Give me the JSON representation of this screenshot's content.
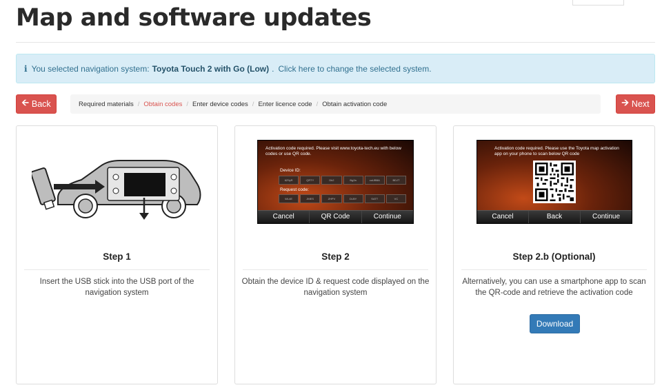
{
  "page": {
    "title": "Map and software updates"
  },
  "alert": {
    "icon": "info-icon",
    "prefix": "You selected navigation system:",
    "system": "Toyota Touch 2 with Go (Low)",
    "suffix": ".",
    "link": "Click here to change the selected system."
  },
  "nav": {
    "back_label": "Back",
    "next_label": "Next",
    "steps": [
      {
        "label": "Required materials",
        "active": false
      },
      {
        "label": "Obtain codes",
        "active": true
      },
      {
        "label": "Enter device codes",
        "active": false
      },
      {
        "label": "Enter licence code",
        "active": false
      },
      {
        "label": "Obtain activation code",
        "active": false
      }
    ]
  },
  "cards": [
    {
      "title": "Step 1",
      "description": "Insert the USB stick into the USB port of the navigation system",
      "illustration": "car-usb-illustration"
    },
    {
      "title": "Step 2",
      "description": "Obtain the device ID & request code displayed on the navigation system",
      "screen": {
        "text": "Activation code required. Please visit www.toyota-tech.eu with below codes or use QR code.",
        "device_label": "Device ID:",
        "request_label": "Request code:",
        "device_codes": [
          "6Z9yR",
          "QRTY",
          "Dk2",
          "Bg2a",
          "cuUBBA",
          "BDJT"
        ],
        "request_codes": [
          "WL4E",
          "JMES",
          "ZHPV",
          "DLBY",
          "SATT",
          "VC"
        ],
        "buttons": [
          "Cancel",
          "QR Code",
          "Continue"
        ]
      }
    },
    {
      "title": "Step 2.b (Optional)",
      "description": "Alternatively, you can use a smartphone app to scan the QR-code and retrieve the activation code",
      "screen": {
        "text": "Activation code required. Please use the Toyota map activation app on your phone to scan below QR code",
        "buttons": [
          "Cancel",
          "Back",
          "Continue"
        ]
      },
      "download_label": "Download"
    }
  ],
  "colors": {
    "danger": "#d9534f",
    "primary": "#337ab7",
    "info_bg": "#d9edf7",
    "info_text": "#31708f"
  }
}
